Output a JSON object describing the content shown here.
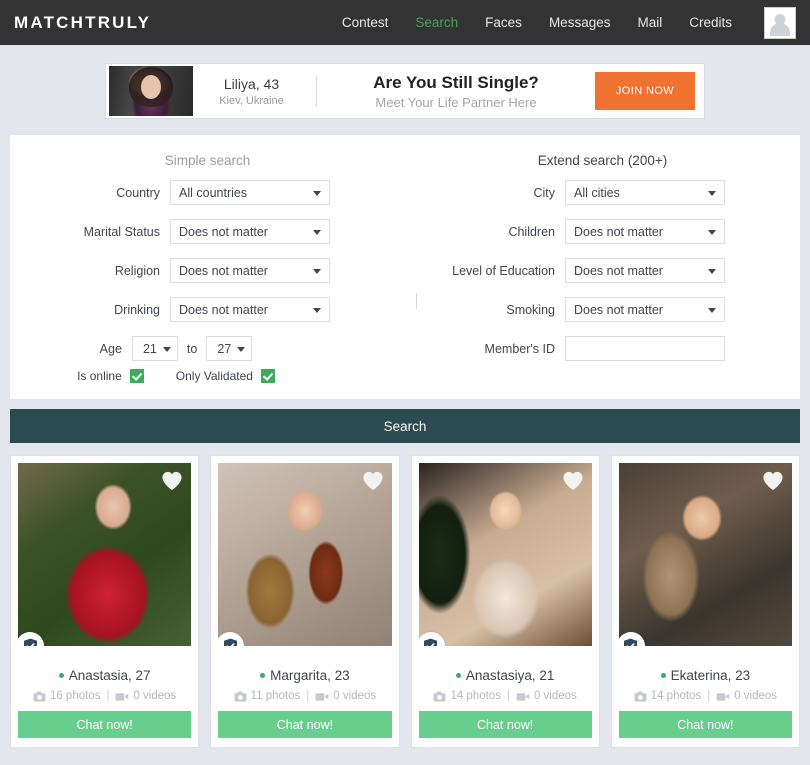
{
  "header": {
    "logo": "MATCHTRULY",
    "nav": [
      {
        "label": "Contest",
        "active": false
      },
      {
        "label": "Search",
        "active": true
      },
      {
        "label": "Faces",
        "active": false
      },
      {
        "label": "Messages",
        "active": false
      },
      {
        "label": "Mail",
        "active": false
      },
      {
        "label": "Credits",
        "active": false
      }
    ],
    "avatar_icon": "user-placeholder-icon",
    "bg_color": "#333333",
    "active_color": "#4d9e62"
  },
  "ad": {
    "name": "Liliya, 43",
    "location": "Kiev, Ukraine",
    "headline": "Are You Still Single?",
    "subline": "Meet Your Life Partner Here",
    "cta": "JOIN NOW",
    "cta_color": "#ef7231"
  },
  "search": {
    "left_title": "Simple search",
    "right_title": "Extend search (200+)",
    "left_fields": [
      {
        "label": "Country",
        "value": "All countries",
        "type": "select"
      },
      {
        "label": "Marital Status",
        "value": "Does not matter",
        "type": "select"
      },
      {
        "label": "Religion",
        "value": "Does not matter",
        "type": "select"
      },
      {
        "label": "Drinking",
        "value": "Does not matter",
        "type": "select"
      }
    ],
    "right_fields": [
      {
        "label": "City",
        "value": "All cities",
        "type": "select"
      },
      {
        "label": "Children",
        "value": "Does not matter",
        "type": "select"
      },
      {
        "label": "Level of Education",
        "value": "Does not matter",
        "type": "select"
      },
      {
        "label": "Smoking",
        "value": "Does not matter",
        "type": "select"
      },
      {
        "label": "Member's ID",
        "value": "",
        "placeholder": "",
        "type": "text"
      }
    ],
    "age": {
      "label": "Age",
      "from": "21",
      "to_label": "to",
      "to": "27"
    },
    "checkboxes": [
      {
        "label": "Is online",
        "checked": true
      },
      {
        "label": "Only Validated",
        "checked": true
      }
    ],
    "submit_label": "Search",
    "submit_color": "#2b4b51"
  },
  "results": [
    {
      "name": "Anastasia, 27",
      "photos": "16 photos",
      "videos": "0 videos",
      "separator": "|",
      "chat_label": "Chat now!",
      "online": true,
      "verified": true,
      "favorite_icon": "heart-icon"
    },
    {
      "name": "Margarita, 23",
      "photos": "11 photos",
      "videos": "0 videos",
      "separator": "|",
      "chat_label": "Chat now!",
      "online": true,
      "verified": true,
      "favorite_icon": "heart-icon"
    },
    {
      "name": "Anastasiya, 21",
      "photos": "14 photos",
      "videos": "0 videos",
      "separator": "|",
      "chat_label": "Chat now!",
      "online": true,
      "verified": true,
      "favorite_icon": "heart-icon"
    },
    {
      "name": "Ekaterina, 23",
      "photos": "14 photos",
      "videos": "0 videos",
      "separator": "|",
      "chat_label": "Chat now!",
      "online": true,
      "verified": true,
      "favorite_icon": "heart-icon"
    }
  ]
}
